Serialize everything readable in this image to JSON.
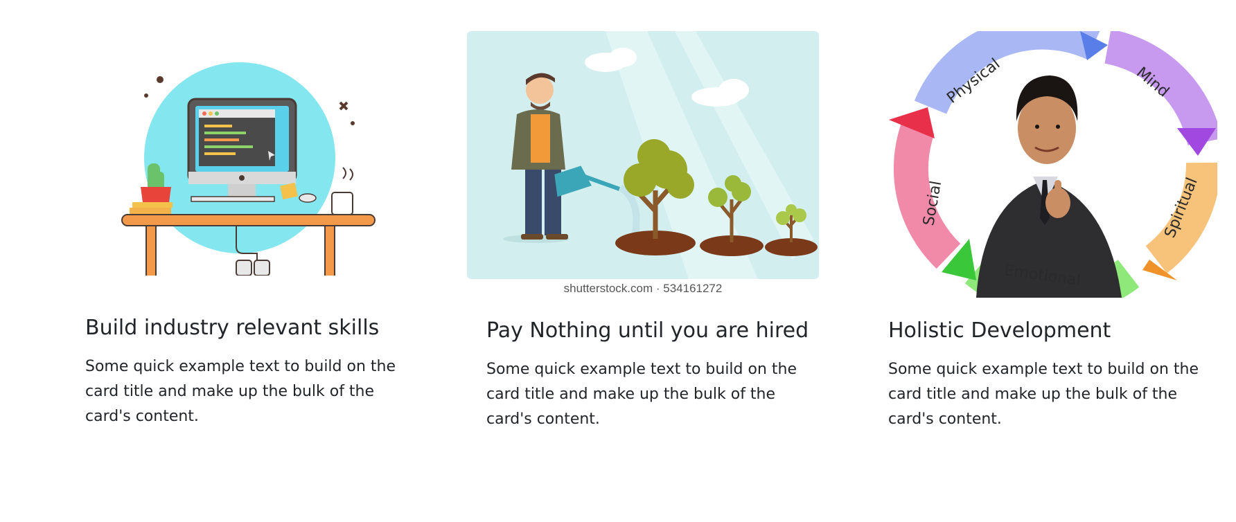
{
  "cards": [
    {
      "title": "Build industry relevant skills",
      "text": "Some quick example text to build on the card title and make up the bulk of the card's content.",
      "image_icon": "workstation-desk-illustration"
    },
    {
      "title": "Pay Nothing until you are hired",
      "text": "Some quick example text to build on the card title and make up the bulk of the card's content.",
      "image_icon": "man-watering-trees-illustration",
      "image_caption": "shutterstock.com · 534161272"
    },
    {
      "title": "Holistic Development",
      "text": "Some quick example text to build on the card title and make up the bulk of the card's content.",
      "image_icon": "boy-thumbs-up-development-cycle",
      "cycle_labels": [
        "Physical",
        "Mind",
        "Spiritual",
        "Emotional",
        "Social"
      ]
    }
  ],
  "colors": {
    "text": "#212529",
    "accent_cyan": "#84e6ef",
    "sky": "#cfeeee"
  }
}
